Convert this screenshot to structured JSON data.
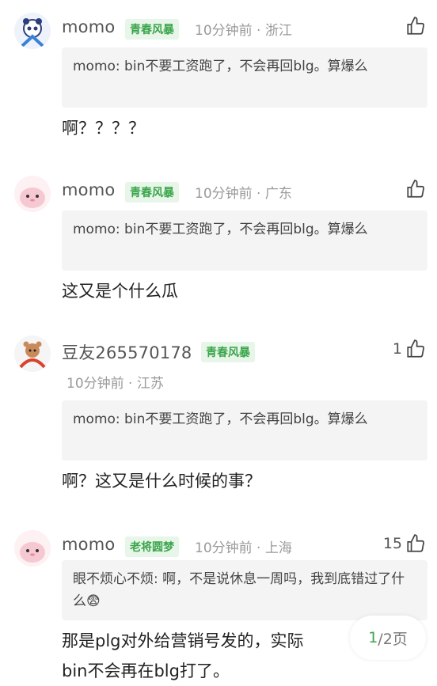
{
  "comments": [
    {
      "username": "momo",
      "badge": "青春风暴",
      "meta": "10分钟前 · 浙江",
      "like_count": "",
      "quote": "momo: bin不要工资跑了，不会再回blg。算爆么",
      "text": "啊？？？？"
    },
    {
      "username": "momo",
      "badge": "青春风暴",
      "meta": "10分钟前 · 广东",
      "like_count": "",
      "quote": "momo: bin不要工资跑了，不会再回blg。算爆么",
      "text": "这又是个什么瓜"
    },
    {
      "username": "豆友265570178",
      "badge": "青春风暴",
      "meta": "10分钟前 · 江苏",
      "like_count": "1",
      "quote": "momo: bin不要工资跑了，不会再回blg。算爆么",
      "text": "啊？这又是什么时候的事？"
    },
    {
      "username": "momo",
      "badge": "老将圆梦",
      "meta": "10分钟前 · 上海",
      "like_count": "15",
      "quote": "眼不烦心不烦: 啊，不是说休息一周吗，我到底错过了什么😨",
      "text_line1": "那是plg对外给营销号发的，实际",
      "text_line2": "bin不会再在blg打了。"
    }
  ],
  "pager": {
    "current": "1",
    "total": "/2页"
  },
  "colors": {
    "badge_text": "#3aa54a",
    "badge_bg": "#e8f6ea",
    "meta": "#9a9a9a"
  },
  "icons": [
    "thumb-up-icon",
    "avatar-panda",
    "avatar-pink-blob",
    "avatar-bear-headband"
  ]
}
